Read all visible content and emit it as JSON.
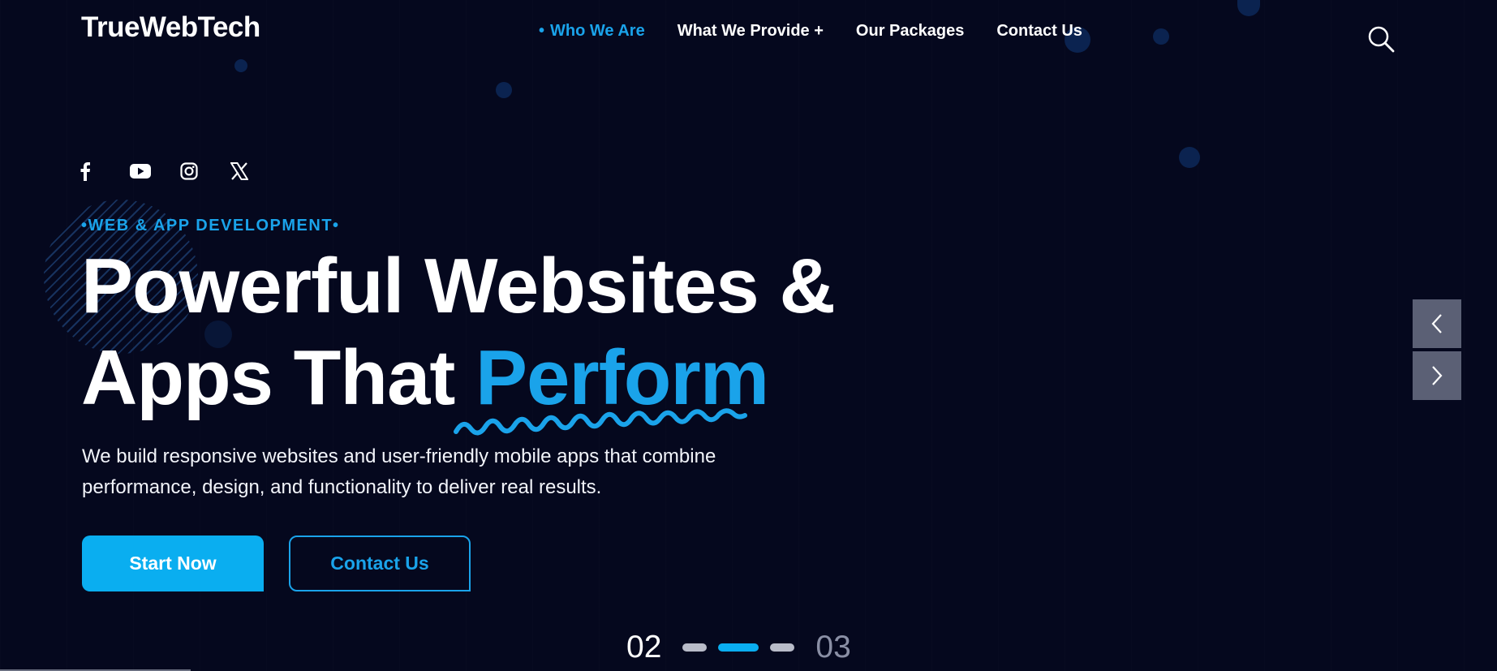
{
  "brand": {
    "logo": "TrueWebTech",
    "accent_color": "#1aa3ea",
    "background": "#05081e"
  },
  "nav": {
    "items": [
      {
        "label": "Who We Are",
        "active": true
      },
      {
        "label": "What We Provide +",
        "active": false
      },
      {
        "label": "Our Packages",
        "active": false
      },
      {
        "label": "Contact Us",
        "active": false
      }
    ],
    "search_icon": "search-icon"
  },
  "socials": [
    "facebook-icon",
    "youtube-icon",
    "instagram-icon",
    "x-icon"
  ],
  "hero": {
    "eyebrow": "•WEB & APP DEVELOPMENT•",
    "headline_line1": "Powerful Websites &",
    "headline_line2_prefix": "Apps That ",
    "headline_line2_accent": "Perform",
    "description": "We build responsive websites and user-friendly mobile apps that combine performance, design, and functionality to deliver real results.",
    "primary_cta": "Start Now",
    "secondary_cta": "Contact Us"
  },
  "slider": {
    "current": "02",
    "next": "03",
    "total_bars": 3,
    "active_bar": 2,
    "prev_icon": "chevron-left-icon",
    "next_icon": "chevron-right-icon"
  }
}
